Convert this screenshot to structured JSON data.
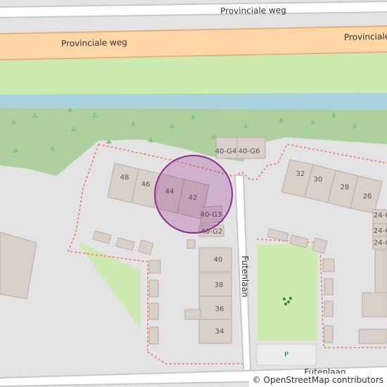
{
  "map": {
    "colors": {
      "background": "#e3e3e3",
      "primary_road": "#fcd6a4",
      "primary_casing": "#e3b27a",
      "minor_road": "#ffffff",
      "road_casing": "#c8c8c8",
      "grass": "#cdebb0",
      "wood": "#add19e",
      "water": "#aad3df",
      "building": "#d9d0c9",
      "building_outline": "#b9ada3",
      "fence": "#f07a6a",
      "marker_fill": "rgba(128,0,128,0.22)",
      "marker_stroke": "#8e2f8e"
    },
    "roads": [
      {
        "id": "provinciale-weg-top",
        "label": "Provinciale weg"
      },
      {
        "id": "provinciale-weg-main",
        "label": "Provinciale weg",
        "label2": "Provinciale"
      },
      {
        "id": "futenlaan-vertical",
        "label": "Futenlaan"
      },
      {
        "id": "futenlaan-bottom",
        "label": "Futenlaan"
      }
    ],
    "house_numbers": [
      "48",
      "46",
      "44",
      "42",
      "40-G4",
      "40-G6",
      "40-G3",
      "40-G2",
      "40",
      "38",
      "36",
      "34",
      "32",
      "30",
      "28",
      "26",
      "24-G",
      "24-G",
      "24-G"
    ],
    "parking_symbol": "P",
    "playground_icon": "playground-icon",
    "location_marker": "location-marker"
  },
  "attribution": {
    "symbol": "©",
    "text": "OpenStreetMap contributors"
  }
}
